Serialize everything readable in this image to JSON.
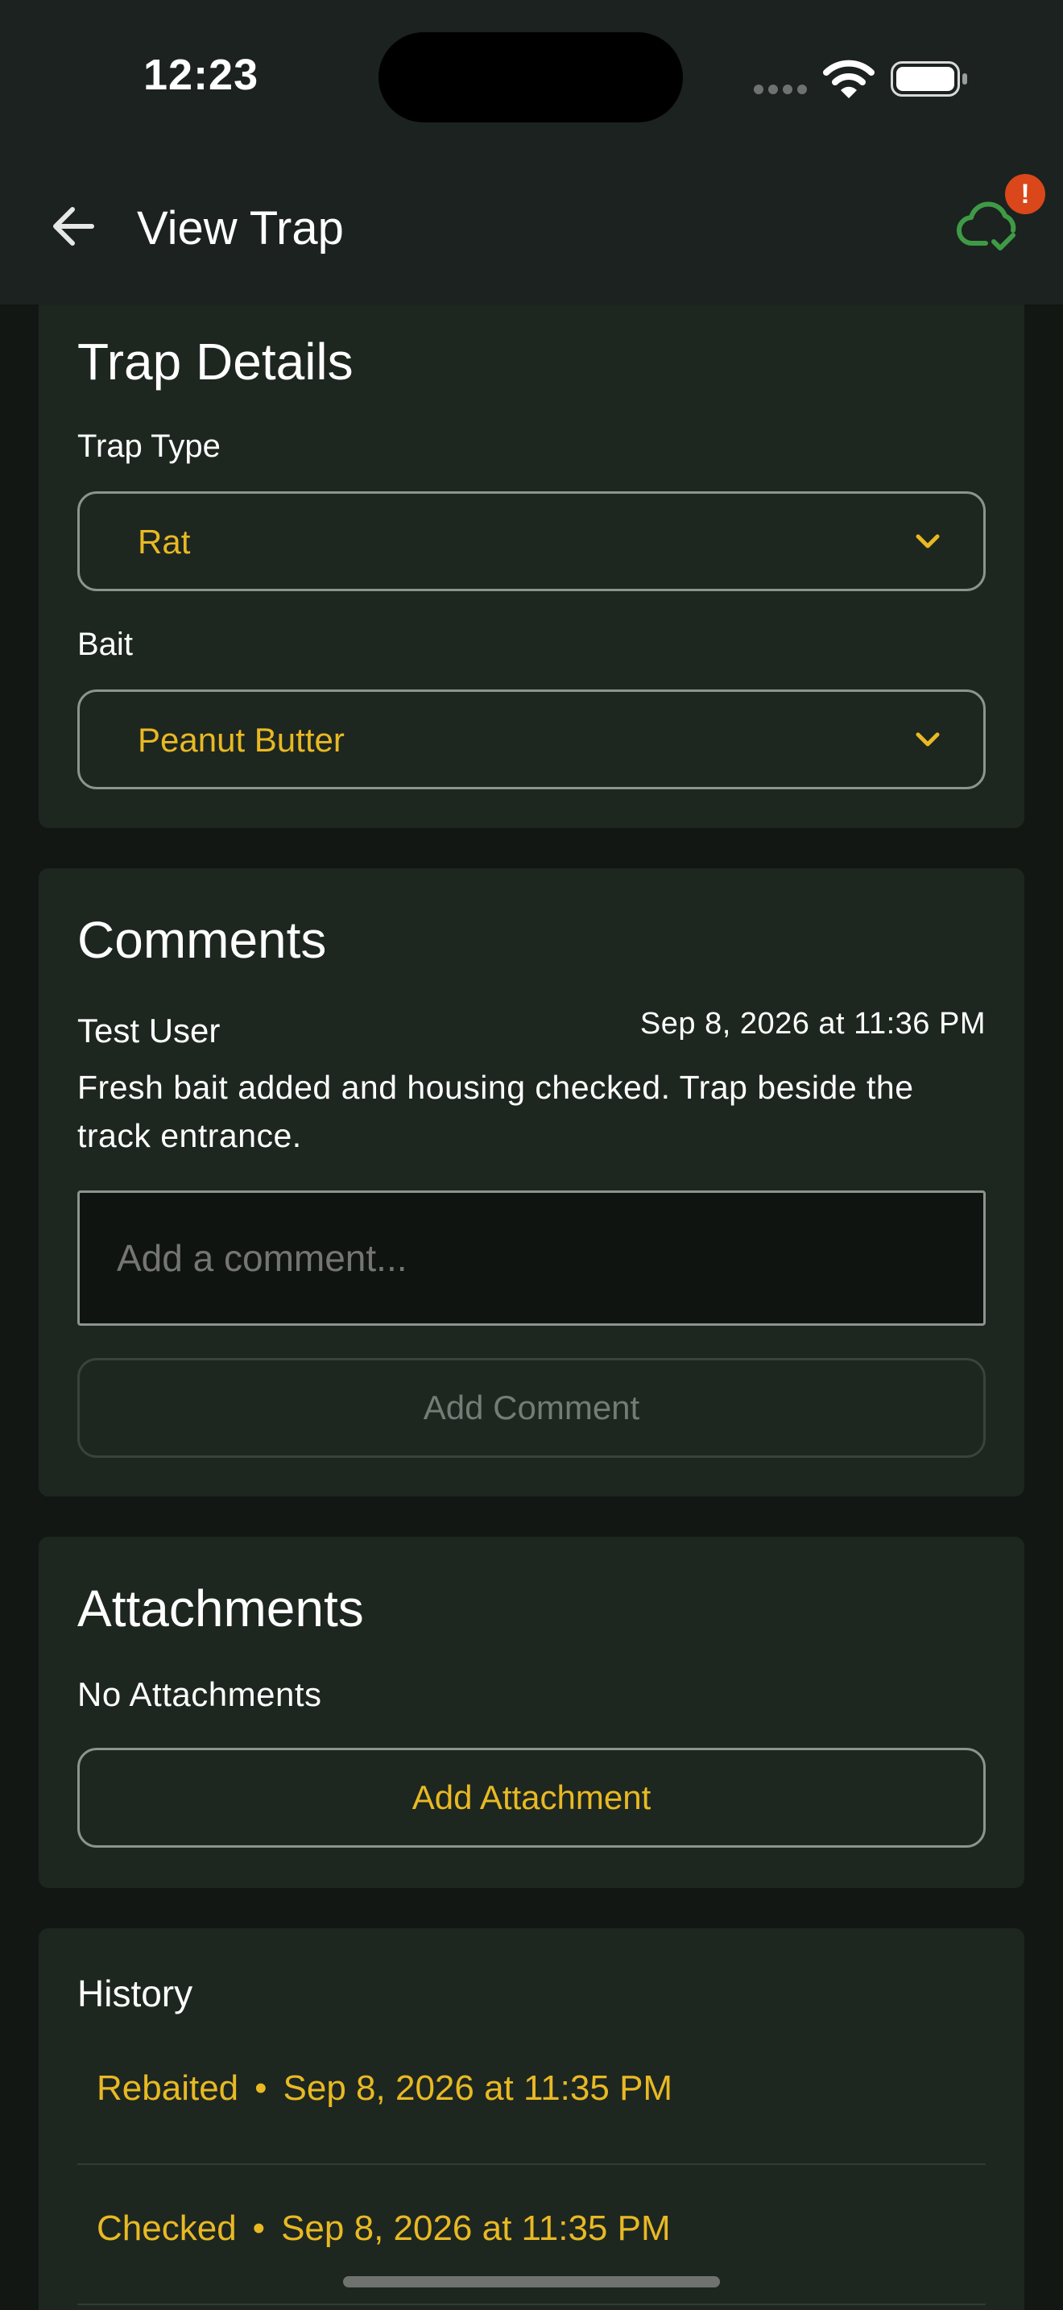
{
  "status_bar": {
    "time": "12:23"
  },
  "app_bar": {
    "title": "View Trap",
    "sync_badge": "!"
  },
  "trap_details": {
    "title": "Trap Details",
    "trap_type_label": "Trap Type",
    "trap_type_value": "Rat",
    "bait_label": "Bait",
    "bait_value": "Peanut Butter"
  },
  "comments": {
    "title": "Comments",
    "items": [
      {
        "author": "Test User",
        "date": "Sep 8, 2026 at 11:36 PM",
        "text": "Fresh bait added and housing checked. Trap beside the track entrance."
      }
    ],
    "input_placeholder": "Add a comment...",
    "add_button": "Add Comment"
  },
  "attachments": {
    "title": "Attachments",
    "empty_text": "No Attachments",
    "add_button": "Add Attachment"
  },
  "history": {
    "title": "History",
    "separator": "•",
    "items": [
      {
        "action": "Rebaited",
        "date": "Sep 8, 2026 at 11:35 PM"
      },
      {
        "action": "Checked",
        "date": "Sep 8, 2026 at 11:35 PM"
      }
    ]
  },
  "colors": {
    "accent": "#e8b923",
    "sync_icon": "#3f9a45",
    "badge": "#d9471b"
  }
}
